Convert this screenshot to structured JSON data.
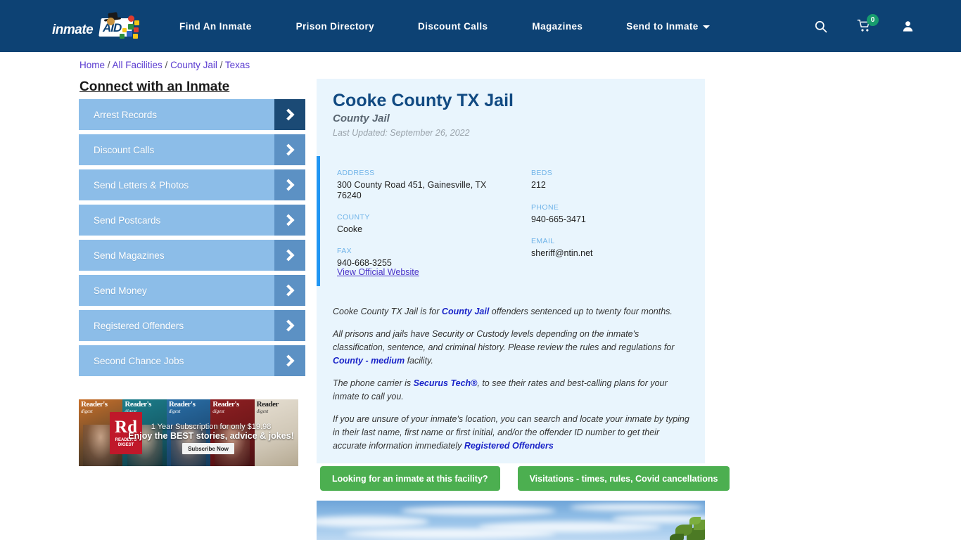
{
  "header": {
    "logo": {
      "text_primary": "inmate",
      "text_secondary": "AID"
    },
    "nav": [
      {
        "label": "Find An Inmate"
      },
      {
        "label": "Prison Directory"
      },
      {
        "label": "Discount Calls"
      },
      {
        "label": "Magazines"
      },
      {
        "label": "Send to Inmate",
        "has_dropdown": true
      }
    ],
    "icons": {
      "search": "search-icon",
      "cart": "shopping-cart-icon",
      "cart_count": "0",
      "account": "user-account-icon"
    },
    "colors": {
      "header_background": "#0d4274",
      "cart_badge": "#179c6e"
    }
  },
  "breadcrumb": {
    "items": [
      "Home",
      "All Facilities",
      "County Jail",
      "Texas"
    ],
    "separator": "/"
  },
  "sidebar": {
    "title": "Connect with an Inmate",
    "items": [
      {
        "label": "Arrest Records",
        "active": true
      },
      {
        "label": "Discount Calls",
        "active": false
      },
      {
        "label": "Send Letters & Photos",
        "active": false
      },
      {
        "label": "Send Postcards",
        "active": false
      },
      {
        "label": "Send Magazines",
        "active": false
      },
      {
        "label": "Send Money",
        "active": false
      },
      {
        "label": "Registered Offenders",
        "active": false
      },
      {
        "label": "Second Chance Jobs",
        "active": false
      }
    ]
  },
  "advertisement": {
    "brand": "Rd",
    "brand_sub": "READER'S DIGEST",
    "line1": "1 Year Subscription for only $19.98",
    "line2": "Enjoy the BEST stories, advice & jokes!",
    "cta": "Subscribe Now",
    "covers": [
      {
        "title": "Reader's",
        "sub": "digest"
      },
      {
        "title": "Reader's",
        "sub": "digest"
      },
      {
        "title": "Reader's",
        "sub": "digest"
      },
      {
        "title": "Reader's",
        "sub": "digest"
      },
      {
        "title": "Reader",
        "sub": "digest"
      }
    ]
  },
  "facility": {
    "name": "Cooke County TX Jail",
    "type": "County Jail",
    "last_updated": "Last Updated: September 26, 2022",
    "details": {
      "address_label": "ADDRESS",
      "address_value": "300 County Road 451, Gainesville, TX 76240",
      "beds_label": "BEDS",
      "beds_value": "212",
      "county_label": "COUNTY",
      "county_value": "Cooke",
      "phone_label": "PHONE",
      "phone_value": "940-665-3471",
      "fax_label": "FAX",
      "fax_value": "940-668-3255",
      "email_label": "EMAIL",
      "email_value": "sheriff@ntin.net"
    },
    "official_website_link": "View Official Website",
    "description": {
      "p1_a": "Cooke County TX Jail is for ",
      "p1_link": "County Jail",
      "p1_b": " offenders sentenced up to twenty four months.",
      "p2_a": "All prisons and jails have Security or Custody levels depending on the inmate's classification, sentence, and criminal history. Please review the rules and regulations for ",
      "p2_link": "County - medium",
      "p2_b": " facility.",
      "p3_a": "The phone carrier is ",
      "p3_link": "Securus Tech®",
      "p3_b": ", to see their rates and best-calling plans for your inmate to call you.",
      "p4_a": "If you are unsure of your inmate's location, you can search and locate your inmate by typing in their last name, first name or first initial, and/or the offender ID number to get their accurate information immediately ",
      "p4_link": "Registered Offenders"
    }
  },
  "cta_buttons": [
    {
      "label": "Looking for an inmate at this facility?"
    },
    {
      "label": "Visitations - times, rules, Covid cancellations"
    }
  ],
  "colors": {
    "card_background": "#e9f5fd",
    "accent_bar": "#2196f3",
    "cta_green": "#4caf50",
    "title_blue": "#114a82",
    "sidebar_blue": "#8cbde8",
    "sidebar_arrow": "#5c91c4",
    "sidebar_arrow_active": "#1b4a75"
  }
}
